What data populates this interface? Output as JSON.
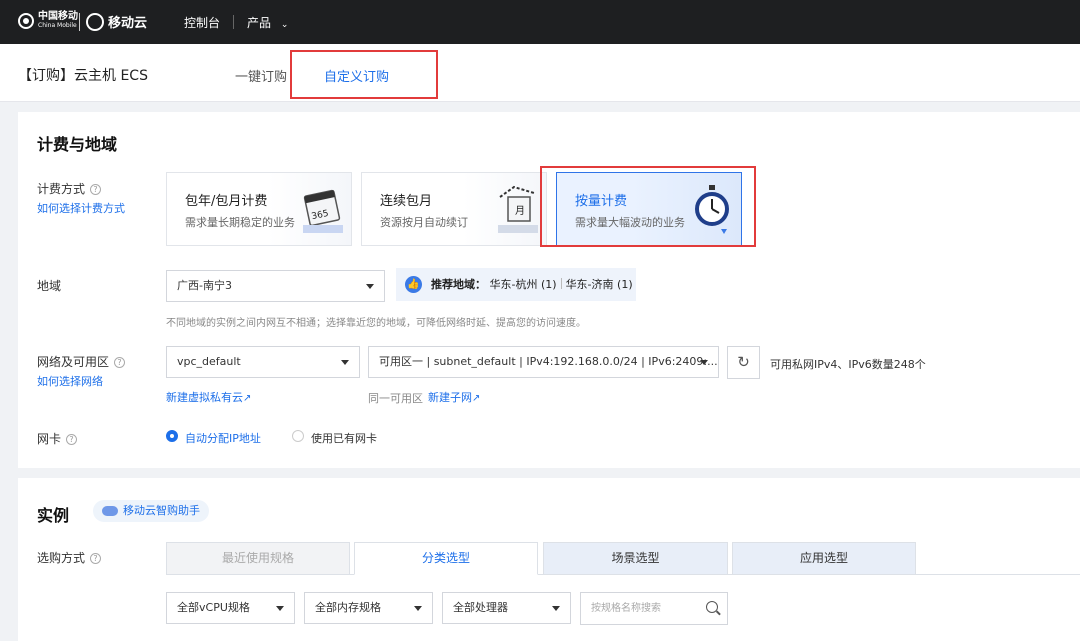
{
  "topnav": {
    "logo_cm_cn": "中国移动",
    "logo_cm_en": "China Mobile",
    "logo_brand": "移动云",
    "console": "控制台",
    "products": "产品"
  },
  "header": {
    "title": "【订购】云主机 ECS",
    "tabs": [
      {
        "label": "一键订购",
        "active": false
      },
      {
        "label": "自定义订购",
        "active": true
      }
    ]
  },
  "billing_region": {
    "section_title": "计费与地域",
    "billing_label": "计费方式",
    "billing_help": "如何选择计费方式",
    "billing_options": [
      {
        "title": "包年/包月计费",
        "desc": "需求量长期稳定的业务",
        "selected": false
      },
      {
        "title": "连续包月",
        "desc": "资源按月自动续订",
        "selected": false
      },
      {
        "title": "按量计费",
        "desc": "需求量大幅波动的业务",
        "selected": true
      }
    ],
    "region_label": "地域",
    "region_value": "广西-南宁3",
    "recommend_key": "推荐地域：",
    "recommend_a": "华东-杭州 (1)",
    "recommend_b": "华东-济南 (1)",
    "region_hint": "不同地域的实例之间内网互不相通；选择靠近您的地域，可降低网络时延、提高您的访问速度。",
    "network_label": "网络及可用区",
    "network_help": "如何选择网络",
    "vpc_value": "vpc_default",
    "subnet_value": "可用区一 | subnet_default | IPv4:192.168.0.0/24 | IPv6:2409:...",
    "ip_count": "可用私网IPv4、IPv6数量248个",
    "new_vpc_link": "新建虚拟私有云",
    "same_zone_text": "同一可用区",
    "new_subnet_link": "新建子网",
    "nic_label": "网卡",
    "nic_options": [
      {
        "label": "自动分配IP地址",
        "selected": true
      },
      {
        "label": "使用已有网卡",
        "selected": false
      }
    ]
  },
  "instance": {
    "section_title": "实例",
    "assistant": "移动云智购助手",
    "purchase_label": "选购方式",
    "tabs": [
      {
        "label": "最近使用规格",
        "state": "disabled"
      },
      {
        "label": "分类选型",
        "state": "active"
      },
      {
        "label": "场景选型",
        "state": "normal"
      },
      {
        "label": "应用选型",
        "state": "normal"
      }
    ],
    "filters": [
      "全部vCPU规格",
      "全部内存规格",
      "全部处理器"
    ],
    "search_placeholder": "按规格名称搜索"
  },
  "highlight_color": "#e23b3b",
  "accent_color": "#1d6fe9"
}
